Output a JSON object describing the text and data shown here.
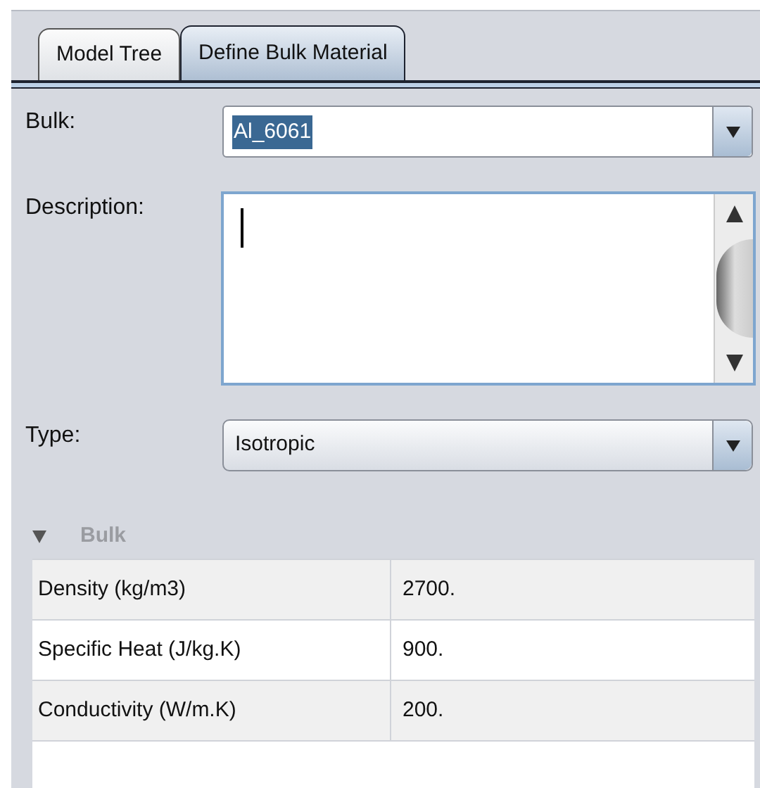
{
  "tabs": [
    {
      "label": "Model Tree",
      "selected": false
    },
    {
      "label": "Define Bulk Material",
      "selected": true
    }
  ],
  "bulk": {
    "label": "Bulk:",
    "value": "Al_6061"
  },
  "description": {
    "label": "Description:"
  },
  "type": {
    "label": "Type:",
    "value": "Isotropic"
  },
  "section": {
    "title": "Bulk",
    "expanded": true
  },
  "properties": [
    {
      "name": "Density (kg/m3)",
      "value": "2700."
    },
    {
      "name": "Specific Heat (J/kg.K)",
      "value": "900."
    },
    {
      "name": "Conductivity (W/m.K)",
      "value": "200."
    }
  ]
}
